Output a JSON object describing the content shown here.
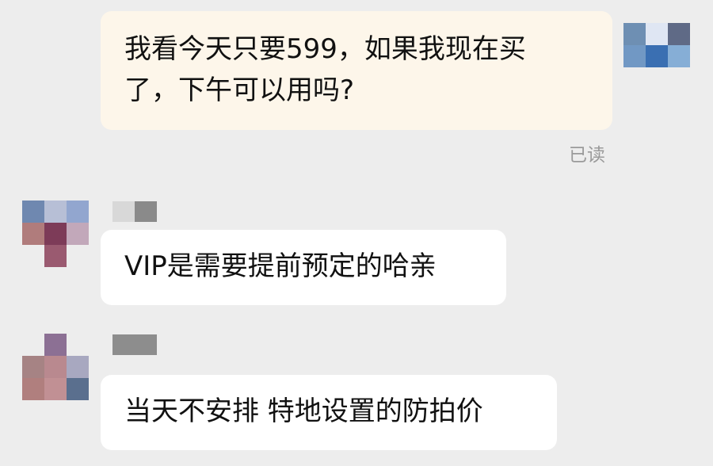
{
  "messages": [
    {
      "sender": "self",
      "text": "我看今天只要599，如果我现在买了，下午可以用吗?",
      "lines": [
        "我看今天只要599，如果我现在买",
        "了，下午可以用吗?"
      ],
      "status": "已读"
    },
    {
      "sender": "other",
      "text": "VIP是需要提前预定的哈亲"
    },
    {
      "sender": "other",
      "text": "当天不安排 特地设置的防拍价"
    }
  ],
  "colors": {
    "background": "#ededed",
    "self_bubble": "#fdf6ea",
    "other_bubble": "#ffffff",
    "read_status": "#9a9a9a"
  }
}
